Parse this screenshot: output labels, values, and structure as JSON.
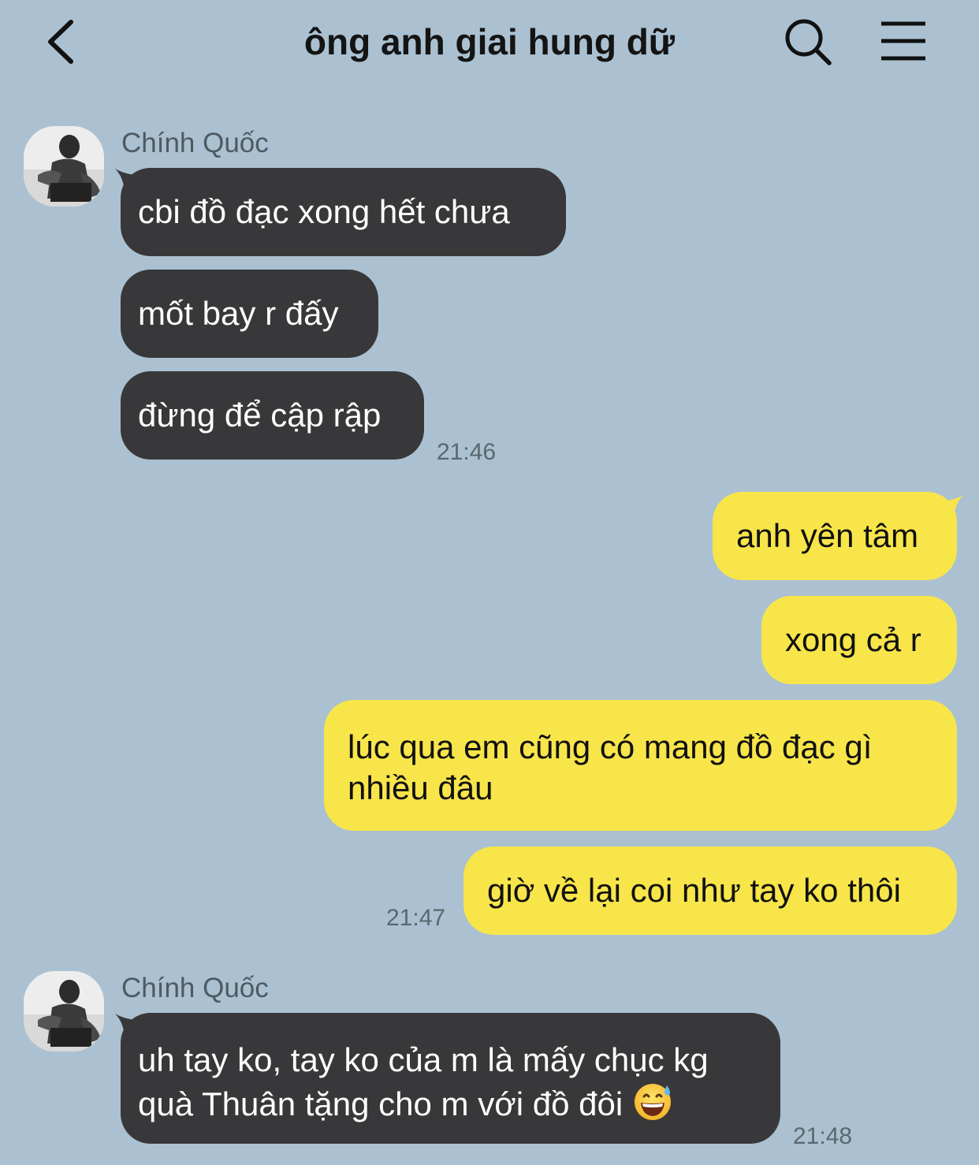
{
  "header": {
    "title": "ông anh giai hung dữ",
    "back_icon": "chevron-left-icon",
    "search_icon": "search-icon",
    "menu_icon": "hamburger-menu-icon"
  },
  "colors": {
    "background": "#abc1d1",
    "incoming_bubble": "#38383a",
    "outgoing_bubble": "#f8e54a"
  },
  "messages": {
    "group1": {
      "sender": "Chính Quốc",
      "items": [
        "cbi đồ đạc xong hết chưa",
        "mốt bay r đấy",
        "đừng để cập rập"
      ],
      "time": "21:46"
    },
    "group2": {
      "items": [
        "anh yên tâm",
        "xong cả r",
        "lúc qua em cũng có mang đồ đạc gì nhiều đâu",
        "giờ về lại coi như tay ko thôi"
      ],
      "time": "21:47"
    },
    "group3": {
      "sender": "Chính Quốc",
      "text": "uh tay ko, tay ko của m là mấy chục kg quà Thuân tặng cho m với đồ đôi",
      "emoji": "grinning-face-with-sweat-icon",
      "time": "21:48"
    }
  }
}
